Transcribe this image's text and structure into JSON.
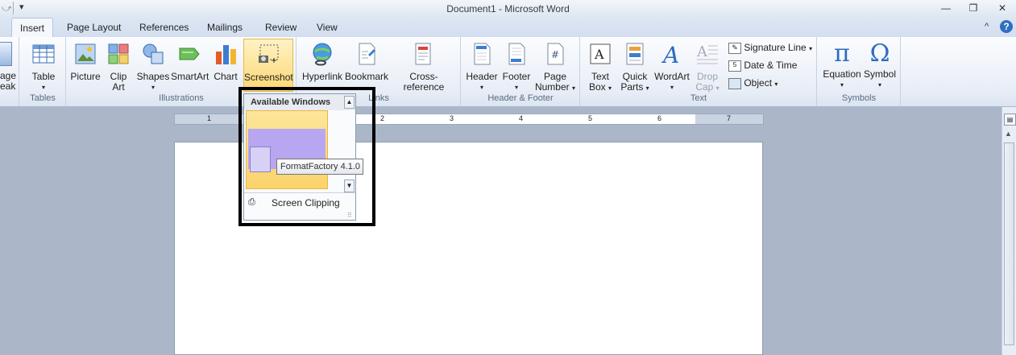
{
  "window": {
    "title": "Document1  -  Microsoft Word",
    "min_icon": "minimize-icon",
    "restore_icon": "restore-icon",
    "close_icon": "close-icon"
  },
  "tabs": [
    {
      "label": "Insert"
    },
    {
      "label": "Page Layout"
    },
    {
      "label": "References"
    },
    {
      "label": "Mailings"
    },
    {
      "label": "Review"
    },
    {
      "label": "View"
    }
  ],
  "ribbon": {
    "pages_partial": {
      "line1": "age",
      "line2": "eak"
    },
    "tables": {
      "label": "Tables",
      "table": "Table"
    },
    "illustrations": {
      "label": "Illustrations",
      "picture": "Picture",
      "clipart_l1": "Clip",
      "clipart_l2": "Art",
      "shapes": "Shapes",
      "smartart": "SmartArt",
      "chart": "Chart",
      "screenshot": "Screenshot"
    },
    "links": {
      "label": "Links",
      "hyperlink": "Hyperlink",
      "bookmark": "Bookmark",
      "crossref": "Cross-reference"
    },
    "header_footer": {
      "label": "Header & Footer",
      "header": "Header",
      "footer": "Footer",
      "pagenum_l1": "Page",
      "pagenum_l2": "Number"
    },
    "text": {
      "label": "Text",
      "textbox_l1": "Text",
      "textbox_l2": "Box",
      "quickparts_l1": "Quick",
      "quickparts_l2": "Parts",
      "wordart": "WordArt",
      "dropcap_l1": "Drop",
      "dropcap_l2": "Cap",
      "signature": "Signature Line",
      "datetime": "Date & Time",
      "object": "Object"
    },
    "symbols": {
      "label": "Symbols",
      "equation": "Equation",
      "symbol": "Symbol"
    }
  },
  "ruler": {
    "numbers": [
      "1",
      "2",
      "3",
      "4",
      "5",
      "6",
      "7"
    ]
  },
  "screenshot_menu": {
    "header": "Available Windows",
    "tooltip": "FormatFactory 4.1.0",
    "clipping": "Screen Clipping"
  }
}
